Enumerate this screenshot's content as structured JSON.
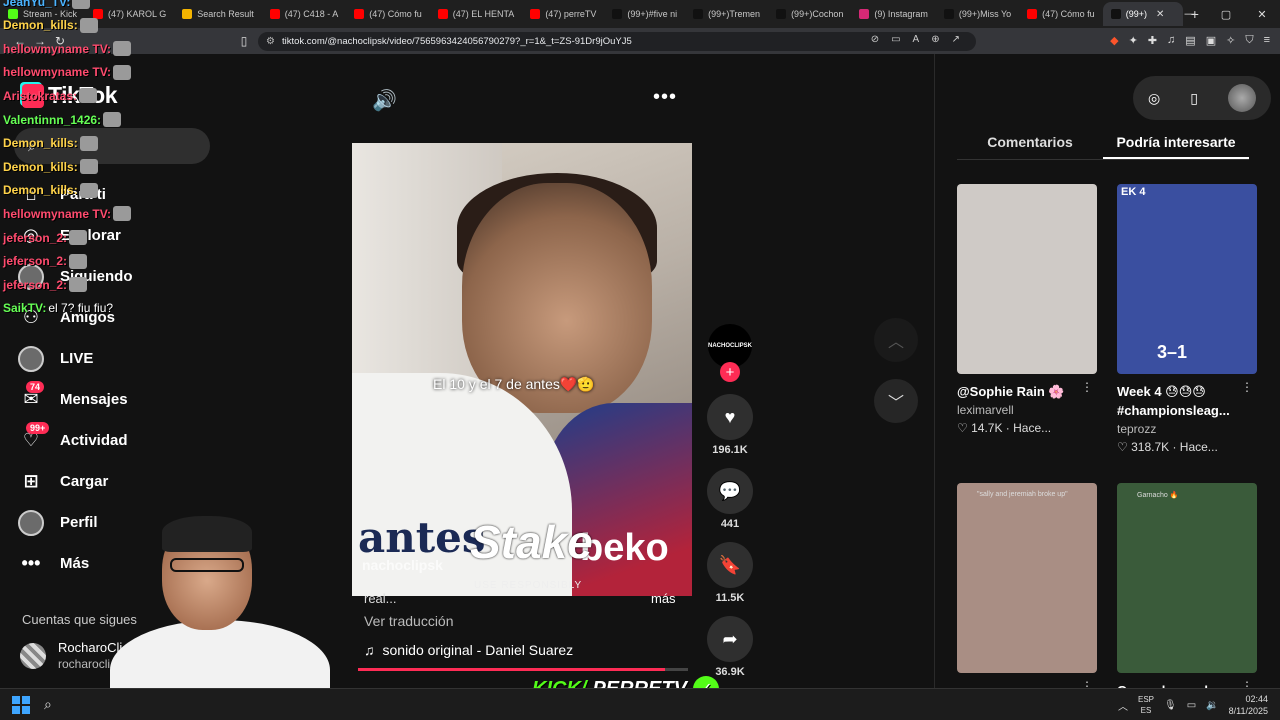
{
  "browser": {
    "tabs": [
      {
        "label": "Stream - Kick",
        "color": "#53fc18"
      },
      {
        "label": "(47) KAROL G",
        "color": "#ff0000"
      },
      {
        "label": "Search Result",
        "color": "#f4b400"
      },
      {
        "label": "(47) C418 - A",
        "color": "#ff0000"
      },
      {
        "label": "(47) Cómo fu",
        "color": "#ff0000"
      },
      {
        "label": "(47) EL HENTA",
        "color": "#ff0000"
      },
      {
        "label": "(47) perreTV",
        "color": "#ff0000"
      },
      {
        "label": "(99+)#five ni",
        "color": "#111111"
      },
      {
        "label": "(99+)Tremen",
        "color": "#111111"
      },
      {
        "label": "(99+)Cochon",
        "color": "#111111"
      },
      {
        "label": "(9) Instagram",
        "color": "#d62976"
      },
      {
        "label": "(99+)Miss Yo",
        "color": "#111111"
      },
      {
        "label": "(47) Cómo fu",
        "color": "#ff0000"
      },
      {
        "label": "(99+)",
        "color": "#111111",
        "active": true
      }
    ],
    "url": "tiktok.com/@nachoclipsk/video/7565963424056790279?_r=1&_t=ZS-91Dr9jOuYJ5"
  },
  "sidebar": {
    "logo": "TikTok",
    "search_icon": "search-icon",
    "items": [
      {
        "label": "Para ti",
        "icon": "home-icon"
      },
      {
        "label": "Explorar",
        "icon": "compass-icon"
      },
      {
        "label": "Siguiendo",
        "icon": "following-avatar-icon"
      },
      {
        "label": "Amigos",
        "icon": "friends-icon"
      },
      {
        "label": "LIVE",
        "icon": "live-icon"
      },
      {
        "label": "Mensajes",
        "icon": "inbox-icon",
        "badge": "74"
      },
      {
        "label": "Actividad",
        "icon": "bell-icon",
        "badge": "99+"
      },
      {
        "label": "Cargar",
        "icon": "upload-icon"
      },
      {
        "label": "Perfil",
        "icon": "profile-icon"
      },
      {
        "label": "Más",
        "icon": "more-icon"
      }
    ],
    "following_title": "Cuentas que sigues",
    "following": {
      "name": "RocharoCli",
      "handle": "rocharocli"
    }
  },
  "video": {
    "caption_overlay": "El 10 y el 7 de antes❤️🫡",
    "jersey_text": "antes",
    "sponsor": "Stake",
    "sponsor_sub": "USE RESPONSIBLY",
    "shirt_brand": "beko",
    "owner_watermark": "nachoclipsk",
    "description_start": "real...",
    "more_label": "más",
    "translate_label": "Ver traducción",
    "music": "sonido original - Daniel Suarez",
    "progress": 0.93
  },
  "actions": {
    "author_avatar": "NACHOCLIPSK",
    "likes": "196.1K",
    "comments": "441",
    "saves": "11.5K",
    "shares": "36.9K"
  },
  "panel": {
    "tabs": [
      "Comentarios",
      "Podría interesarte"
    ],
    "active_tab": 1,
    "cards": [
      {
        "title": "@Sophie Rain 🌸",
        "author": "leximarvell",
        "stats": "14.7K · Hace...",
        "color": "#cfcac6"
      },
      {
        "title": "Week 4 😓😓😓 #championsleag...",
        "author": "teprozz",
        "stats": "318.7K · Hace...",
        "color": "#3a4fa0",
        "label": "EK 4",
        "score": "3–1"
      },
      {
        "title": "",
        "author": "",
        "stats": "",
        "color": "#a98e84",
        "tag": "\"sally and jeremiah broke up\""
      },
      {
        "title": "Garnacho goal",
        "author": "",
        "stats": "",
        "color": "#3a5b3a",
        "tag": "Garnacho 🔥"
      }
    ]
  },
  "overlay": {
    "chat": [
      {
        "user": "JeanYu_TV:",
        "color": "#4ab3ff",
        "msg": ""
      },
      {
        "user": "Demon_kills:",
        "color": "#ffd34a",
        "msg": ""
      },
      {
        "user": "hellowmyname TV:",
        "color": "#ff4b6e",
        "msg": ""
      },
      {
        "user": "hellowmyname TV:",
        "color": "#ff4b6e",
        "msg": ""
      },
      {
        "user": "Aristokratas:",
        "color": "#ff4b6e",
        "msg": ""
      },
      {
        "user": "Valentinnn_1426:",
        "color": "#66ff55",
        "msg": ""
      },
      {
        "user": "Demon_kills:",
        "color": "#ffd34a",
        "msg": ""
      },
      {
        "user": "Demon_kills:",
        "color": "#ffd34a",
        "msg": ""
      },
      {
        "user": "Demon_kills:",
        "color": "#ffd34a",
        "msg": ""
      },
      {
        "user": "hellowmyname TV:",
        "color": "#ff4b6e",
        "msg": ""
      },
      {
        "user": "jeferson_2:",
        "color": "#ff4b6e",
        "msg": ""
      },
      {
        "user": "jeferson_2:",
        "color": "#ff4b6e",
        "msg": ""
      },
      {
        "user": "jeferson_2:",
        "color": "#ff4b6e",
        "msg": ""
      },
      {
        "user": "SaikTV:",
        "color": "#66ff55",
        "msg": " el 7? fiu fiu?"
      }
    ],
    "kick_brand": "KICK/",
    "kick_channel": "PERRETV"
  },
  "taskbar": {
    "lang_top": "ESP",
    "lang_bottom": "ES",
    "time": "02:44",
    "date": "8/11/2025"
  }
}
